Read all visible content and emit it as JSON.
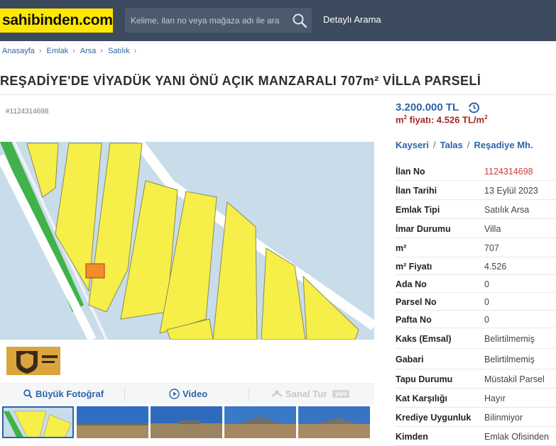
{
  "header": {
    "logo": "sahibinden.com",
    "search_placeholder": "Kelime, ilan no veya mağaza adı ile ara",
    "detailed_search": "Detaylı Arama"
  },
  "breadcrumb": [
    "Anasayfa",
    "Emlak",
    "Arsa",
    "Satılık"
  ],
  "listing": {
    "title": "REŞADİYE'DE VİYADÜK YANI ÖNÜ AÇIK MANZARALI 707m² VİLLA PARSELİ",
    "id_label": "#1124314698",
    "price": "3.200.000 TL",
    "m2_price_prefix": "m",
    "m2_price_sup": "2",
    "m2_price_value": " fiyatı: 4.526 TL/m",
    "m2_price_sup2": "2",
    "location": [
      "Kayseri",
      "Talas",
      "Reşadiye Mh."
    ]
  },
  "media": {
    "big_photo": "Büyük Fotoğraf",
    "video": "Video",
    "virtual_tour": "Sanal Tur",
    "virtual_badge": "yeni"
  },
  "details": [
    {
      "key": "İlan No",
      "value": "1124314698",
      "highlight": true
    },
    {
      "key": "İlan Tarihi",
      "value": "13 Eylül 2023"
    },
    {
      "key": "Emlak Tipi",
      "value": "Satılık Arsa"
    },
    {
      "key": "İmar Durumu",
      "value": "Villa"
    },
    {
      "key": "m²",
      "value": "707"
    },
    {
      "key": "m² Fiyatı",
      "value": "4.526"
    },
    {
      "key": "Ada No",
      "value": "0"
    },
    {
      "key": "Parsel No",
      "value": "0"
    },
    {
      "key": "Pafta No",
      "value": "0"
    },
    {
      "key": "Kaks (Emsal)",
      "value": "Belirtilmemiş"
    },
    {
      "key": "Gabari",
      "value": "Belirtilmemiş"
    },
    {
      "key": "Tapu Durumu",
      "value": "Müstakil Parsel"
    },
    {
      "key": "Kat Karşılığı",
      "value": "Hayır"
    },
    {
      "key": "Krediye Uygunluk",
      "value": "Bilinmiyor"
    },
    {
      "key": "Kimden",
      "value": "Emlak Ofisinden"
    }
  ],
  "colors": {
    "topbar": "#3b4a5c",
    "logo_bg": "#ffe800",
    "link": "#2c64a8",
    "price_m2": "#a42626",
    "parcel": "#f6ef4a"
  }
}
